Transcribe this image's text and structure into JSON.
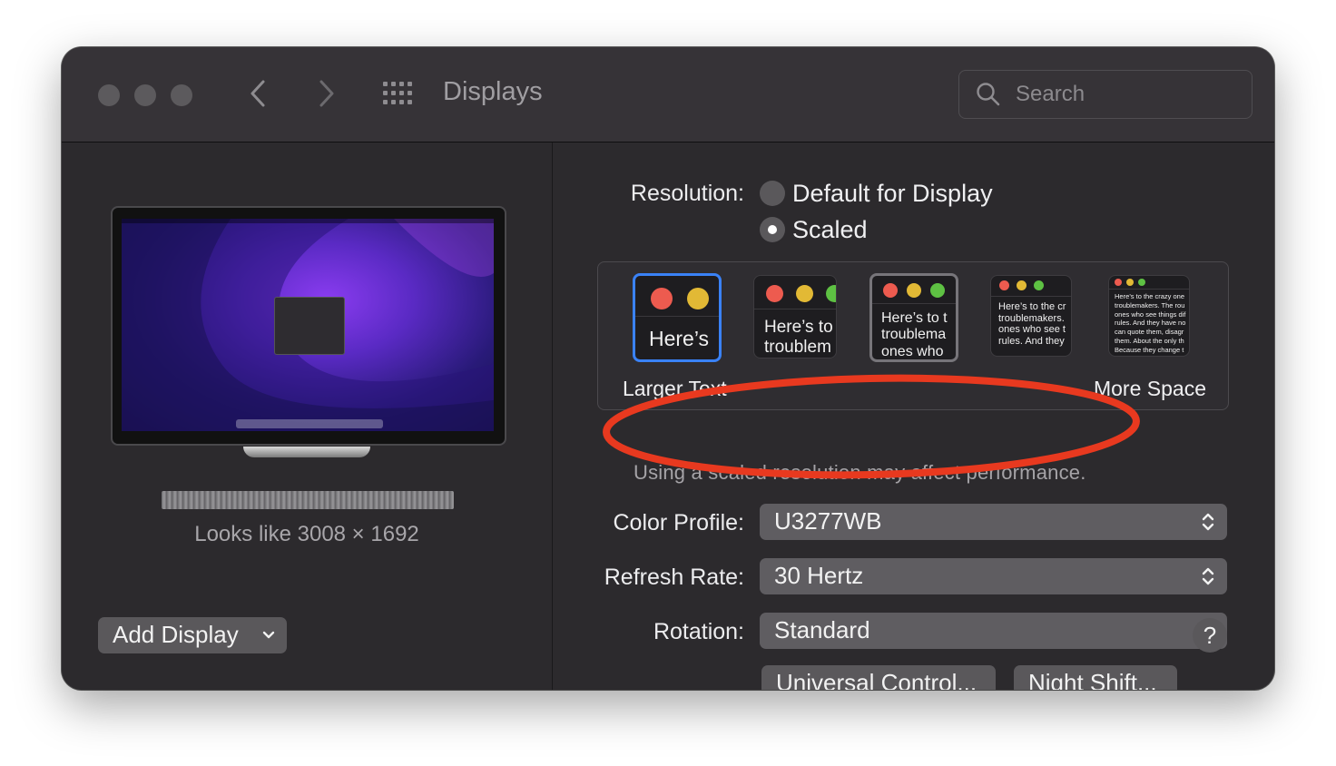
{
  "window": {
    "title": "Displays"
  },
  "search": {
    "placeholder": "Search"
  },
  "sidebar": {
    "looks_like": "Looks like 3008 × 1692",
    "add_display_label": "Add Display"
  },
  "resolution": {
    "label": "Resolution:",
    "options": [
      {
        "label": "Default for Display",
        "selected": false
      },
      {
        "label": "Scaled",
        "selected": true
      }
    ],
    "scale_left_label": "Larger Text",
    "scale_right_label": "More Space",
    "selected_thumbnail": 1,
    "thumbnails": [
      {
        "text": "Here’s"
      },
      {
        "text": "Here’s to\ntroublem"
      },
      {
        "text": "Here’s to t\ntroublema\nones who"
      },
      {
        "text": "Here’s to the cr\ntroublemakers.\nones who see t\nrules. And they"
      },
      {
        "text": "Here’s to the crazy one\ntroublemakers. The rou\nones who see things dif\nrules. And they have no\ncan quote them, disagr\nthem. About the only th\nBecause they change t"
      }
    ]
  },
  "warning": "Using a scaled resolution may affect performance.",
  "color_profile": {
    "label": "Color Profile:",
    "value": "U3277WB"
  },
  "refresh_rate": {
    "label": "Refresh Rate:",
    "value": "30 Hertz"
  },
  "rotation": {
    "label": "Rotation:",
    "value": "Standard"
  },
  "buttons": {
    "universal_control": "Universal Control...",
    "night_shift": "Night Shift...",
    "help": "?"
  },
  "colors": {
    "window_bg": "#2c2a2d",
    "accent_blue": "#3a82f7",
    "annotation_red": "#e8391f",
    "traffic_red": "#ed5b4f",
    "traffic_yellow": "#e2b935",
    "traffic_green": "#5ec143"
  }
}
